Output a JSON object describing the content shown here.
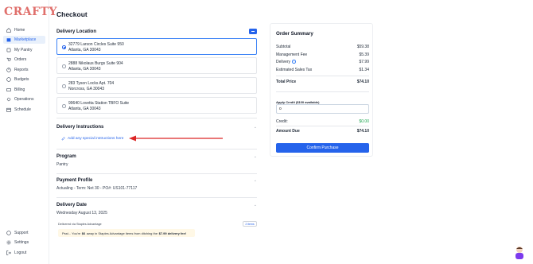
{
  "brand": {
    "logo_text": "CRAFTY",
    "logo_color": "#e0706c",
    "accent": "#2563eb"
  },
  "sidebar": {
    "items": [
      {
        "label": "Home",
        "icon": "home-icon"
      },
      {
        "label": "Marketplace",
        "icon": "store-icon",
        "active": true
      },
      {
        "label": "My Pantry",
        "icon": "pantry-icon"
      },
      {
        "label": "Orders",
        "icon": "orders-icon"
      },
      {
        "label": "Reports",
        "icon": "reports-icon"
      },
      {
        "label": "Budgets",
        "icon": "budgets-icon"
      },
      {
        "label": "Billing",
        "icon": "billing-icon"
      },
      {
        "label": "Operations",
        "icon": "operations-icon"
      },
      {
        "label": "Schedule",
        "icon": "calendar-icon"
      }
    ],
    "bottom_items": [
      {
        "label": "Support",
        "icon": "help-icon"
      },
      {
        "label": "Settings",
        "icon": "gear-icon"
      },
      {
        "label": "Logout",
        "icon": "logout-icon"
      }
    ]
  },
  "page": {
    "title": "Checkout"
  },
  "delivery_location": {
    "title": "Delivery Location",
    "addresses": [
      {
        "line1": "32779 Larson Circles Suite 950",
        "line2": "Atlanta, GA 30043",
        "selected": true
      },
      {
        "line1": "2888 Nikolaus Burgs Suite 904",
        "line2": "Atlanta, GA 30043",
        "selected": false
      },
      {
        "line1": "283 Tyson Locks Apt. 704",
        "line2": "Norcross, GA 30043",
        "selected": false
      },
      {
        "line1": "99640 Lovetta Station TBFO Suite",
        "line2": "Atlanta, GA 30043",
        "selected": false
      }
    ]
  },
  "delivery_instructions": {
    "title": "Delivery Instructions",
    "link": "Add any special instructions here"
  },
  "program": {
    "title": "Program",
    "value": "Pantry"
  },
  "payment_profile": {
    "title": "Payment Profile",
    "value": "Actualing - Term: Net 30 - PO#: US101-77117"
  },
  "delivery_date": {
    "title": "Delivery Date",
    "value": "Wednesday August 13, 2025",
    "delivered_via": "Delivered via Staples Advantage",
    "items_pill": "2 items",
    "promo_pre": "Psst... You're",
    "promo_amount1": "$6",
    "promo_mid": "away in Staples Advantage items from ditching the",
    "promo_amount2": "$7.99 delivery fee!"
  },
  "order_summary": {
    "title": "Order Summary",
    "rows": [
      {
        "label": "Subtotal",
        "value": "$59.38"
      },
      {
        "label": "Management Fee",
        "value": "$5.39"
      },
      {
        "label": "Delivery",
        "value": "$7.99"
      },
      {
        "label": "Estimated Sales Tax",
        "value": "$1.34"
      }
    ],
    "total_label": "Total Price",
    "total_value": "$74.10",
    "credit_label": "Apply Credit ($100 available)",
    "credit_input_value": "0",
    "credit_row_label": "Credit:",
    "credit_row_value": "$0.00",
    "amount_due_label": "Amount Due",
    "amount_due_value": "$74.10",
    "confirm_label": "Confirm Purchase"
  }
}
